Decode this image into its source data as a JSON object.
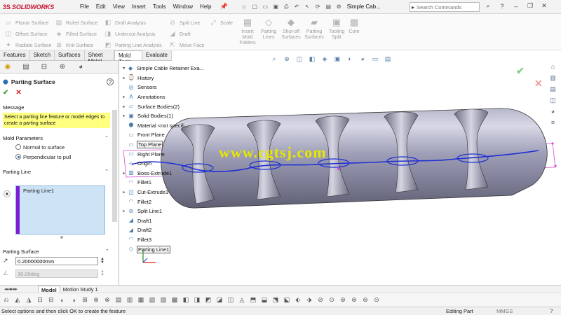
{
  "app": {
    "name": "SOLIDWORKS",
    "brand_mark": "3S",
    "brand_color": "#c8102e",
    "document_title": "Simple Cab...",
    "search_placeholder": "Search Commands"
  },
  "menus": [
    "File",
    "Edit",
    "View",
    "Insert",
    "Tools",
    "Window",
    "Help"
  ],
  "command_manager": {
    "columns": [
      [
        "Planar Surface",
        "Offset Surface",
        "Radiate Surface"
      ],
      [
        "Ruled Surface",
        "Filled Surface",
        "Knit Surface"
      ],
      [
        "Draft Analysis",
        "Undercut Analysis",
        "Parting Line Analysis"
      ],
      [
        "Split Line",
        "Draft",
        "Move Face"
      ],
      [
        "Scale"
      ]
    ],
    "big_buttons": [
      {
        "label": "Insert Mold Folders"
      },
      {
        "label": "Parting Lines"
      },
      {
        "label": "Shut-off Surfaces"
      },
      {
        "label": "Parting Surfaces"
      },
      {
        "label": "Tooling Split"
      },
      {
        "label": "Core"
      }
    ]
  },
  "tabs": [
    "Features",
    "Sketch",
    "Surfaces",
    "Sheet Metal",
    "Mold Tools",
    "Evaluate"
  ],
  "active_tab": "Mold Tools",
  "property_manager": {
    "title": "Parting Surface",
    "message_heading": "Message",
    "message": "Select a parting line feature or model edges to create a parting surface",
    "mold_parameters_heading": "Mold Parameters",
    "mold_options": [
      "Normal to surface",
      "Perpendicular to pull"
    ],
    "selected_option": 1,
    "parting_line_heading": "Parting Line",
    "parting_line_items": [
      "Parting Line1"
    ],
    "parting_surface_heading": "Parting Surface",
    "distance_value": "0.20000000mm",
    "angle_value": "30.00deg"
  },
  "feature_tree": [
    {
      "label": "Simple Cable Retainer Exa...",
      "icon": "part-icon",
      "expander": "▾"
    },
    {
      "label": "History",
      "icon": "history-icon",
      "expander": "▸"
    },
    {
      "label": "Sensors",
      "icon": "sensor-icon",
      "expander": ""
    },
    {
      "label": "Annotations",
      "icon": "annotation-icon",
      "expander": "▸"
    },
    {
      "label": "Surface Bodies(2)",
      "icon": "surface-bodies-icon",
      "expander": "▸"
    },
    {
      "label": "Solid Bodies(1)",
      "icon": "solid-bodies-icon",
      "expander": "▸"
    },
    {
      "label": "Material <not specifi...",
      "icon": "material-icon",
      "expander": ""
    },
    {
      "label": "Front Plane",
      "icon": "plane-icon",
      "expander": ""
    },
    {
      "label": "Top Plane",
      "icon": "plane-icon",
      "expander": "",
      "selected": true
    },
    {
      "label": "Right Plane",
      "icon": "plane-icon",
      "expander": ""
    },
    {
      "label": "Origin",
      "icon": "origin-icon",
      "expander": ""
    },
    {
      "label": "Boss-Extrude1",
      "icon": "extrude-icon",
      "expander": "▸"
    },
    {
      "label": "Fillet1",
      "icon": "fillet-icon",
      "expander": ""
    },
    {
      "label": "Cut-Extrude1",
      "icon": "cut-icon",
      "expander": "▸"
    },
    {
      "label": "Fillet2",
      "icon": "fillet-icon",
      "expander": ""
    },
    {
      "label": "Split Line1",
      "icon": "split-line-icon",
      "expander": "▸"
    },
    {
      "label": "Draft1",
      "icon": "draft-icon",
      "expander": ""
    },
    {
      "label": "Draft2",
      "icon": "draft-icon",
      "expander": ""
    },
    {
      "label": "Fillet3",
      "icon": "fillet-icon",
      "expander": ""
    },
    {
      "label": "Parting Line1",
      "icon": "parting-line-icon",
      "expander": "",
      "selected": true
    }
  ],
  "watermark": "www.cgtsj.com",
  "bottom_tabs": [
    "Model",
    "Motion Study 1"
  ],
  "active_bottom_tab": "Model",
  "status": {
    "message": "Select options and then click OK to create the feature",
    "mode": "Editing Part",
    "units": "MMGS"
  },
  "colors": {
    "parting_line": "#1f2fd4",
    "selection_magenta": "#d24ad2",
    "message_yellow": "#ffff80",
    "list_purple": "#7a1ed6"
  }
}
